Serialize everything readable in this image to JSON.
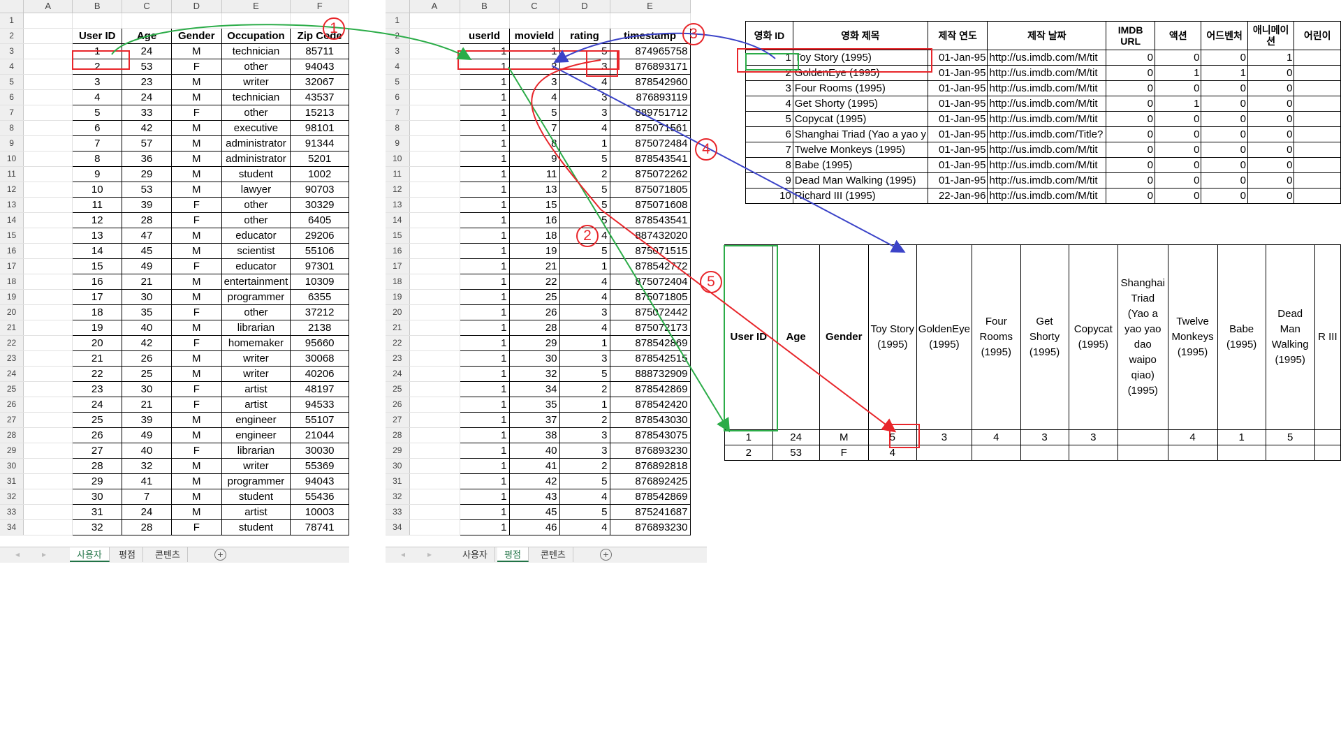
{
  "sheet1": {
    "col_headers": [
      "",
      "A",
      "B",
      "C",
      "D",
      "E",
      "F"
    ],
    "row_numbers": [
      "1",
      "2",
      "3",
      "4",
      "5",
      "6",
      "7",
      "8",
      "9",
      "10",
      "11",
      "12",
      "13",
      "14",
      "15",
      "16",
      "17",
      "18",
      "19",
      "20",
      "21",
      "22",
      "23",
      "24",
      "25",
      "26",
      "27",
      "28",
      "29",
      "30",
      "31",
      "32",
      "33",
      "34"
    ],
    "header": [
      "User ID",
      "Age",
      "Gender",
      "Occupation",
      "Zip Code"
    ],
    "rows": [
      [
        "1",
        "24",
        "M",
        "technician",
        "85711"
      ],
      [
        "2",
        "53",
        "F",
        "other",
        "94043"
      ],
      [
        "3",
        "23",
        "M",
        "writer",
        "32067"
      ],
      [
        "4",
        "24",
        "M",
        "technician",
        "43537"
      ],
      [
        "5",
        "33",
        "F",
        "other",
        "15213"
      ],
      [
        "6",
        "42",
        "M",
        "executive",
        "98101"
      ],
      [
        "7",
        "57",
        "M",
        "administrator",
        "91344"
      ],
      [
        "8",
        "36",
        "M",
        "administrator",
        "5201"
      ],
      [
        "9",
        "29",
        "M",
        "student",
        "1002"
      ],
      [
        "10",
        "53",
        "M",
        "lawyer",
        "90703"
      ],
      [
        "11",
        "39",
        "F",
        "other",
        "30329"
      ],
      [
        "12",
        "28",
        "F",
        "other",
        "6405"
      ],
      [
        "13",
        "47",
        "M",
        "educator",
        "29206"
      ],
      [
        "14",
        "45",
        "M",
        "scientist",
        "55106"
      ],
      [
        "15",
        "49",
        "F",
        "educator",
        "97301"
      ],
      [
        "16",
        "21",
        "M",
        "entertainment",
        "10309"
      ],
      [
        "17",
        "30",
        "M",
        "programmer",
        "6355"
      ],
      [
        "18",
        "35",
        "F",
        "other",
        "37212"
      ],
      [
        "19",
        "40",
        "M",
        "librarian",
        "2138"
      ],
      [
        "20",
        "42",
        "F",
        "homemaker",
        "95660"
      ],
      [
        "21",
        "26",
        "M",
        "writer",
        "30068"
      ],
      [
        "22",
        "25",
        "M",
        "writer",
        "40206"
      ],
      [
        "23",
        "30",
        "F",
        "artist",
        "48197"
      ],
      [
        "24",
        "21",
        "F",
        "artist",
        "94533"
      ],
      [
        "25",
        "39",
        "M",
        "engineer",
        "55107"
      ],
      [
        "26",
        "49",
        "M",
        "engineer",
        "21044"
      ],
      [
        "27",
        "40",
        "F",
        "librarian",
        "30030"
      ],
      [
        "28",
        "32",
        "M",
        "writer",
        "55369"
      ],
      [
        "29",
        "41",
        "M",
        "programmer",
        "94043"
      ],
      [
        "30",
        "7",
        "M",
        "student",
        "55436"
      ],
      [
        "31",
        "24",
        "M",
        "artist",
        "10003"
      ],
      [
        "32",
        "28",
        "F",
        "student",
        "78741"
      ]
    ],
    "tabs": [
      "사용자",
      "평점",
      "콘텐츠"
    ],
    "active_tab": 0
  },
  "sheet2": {
    "col_headers": [
      "",
      "A",
      "B",
      "C",
      "D",
      "E"
    ],
    "header": [
      "userId",
      "movieId",
      "rating",
      "timestamp"
    ],
    "rows": [
      [
        "1",
        "1",
        "5",
        "874965758"
      ],
      [
        "1",
        "2",
        "3",
        "876893171"
      ],
      [
        "1",
        "3",
        "4",
        "878542960"
      ],
      [
        "1",
        "4",
        "3",
        "876893119"
      ],
      [
        "1",
        "5",
        "3",
        "889751712"
      ],
      [
        "1",
        "7",
        "4",
        "875071561"
      ],
      [
        "1",
        "8",
        "1",
        "875072484"
      ],
      [
        "1",
        "9",
        "5",
        "878543541"
      ],
      [
        "1",
        "11",
        "2",
        "875072262"
      ],
      [
        "1",
        "13",
        "5",
        "875071805"
      ],
      [
        "1",
        "15",
        "5",
        "875071608"
      ],
      [
        "1",
        "16",
        "5",
        "878543541"
      ],
      [
        "1",
        "18",
        "4",
        "887432020"
      ],
      [
        "1",
        "19",
        "5",
        "875071515"
      ],
      [
        "1",
        "21",
        "1",
        "878542772"
      ],
      [
        "1",
        "22",
        "4",
        "875072404"
      ],
      [
        "1",
        "25",
        "4",
        "875071805"
      ],
      [
        "1",
        "26",
        "3",
        "875072442"
      ],
      [
        "1",
        "28",
        "4",
        "875072173"
      ],
      [
        "1",
        "29",
        "1",
        "878542869"
      ],
      [
        "1",
        "30",
        "3",
        "878542515"
      ],
      [
        "1",
        "32",
        "5",
        "888732909"
      ],
      [
        "1",
        "34",
        "2",
        "878542869"
      ],
      [
        "1",
        "35",
        "1",
        "878542420"
      ],
      [
        "1",
        "37",
        "2",
        "878543030"
      ],
      [
        "1",
        "38",
        "3",
        "878543075"
      ],
      [
        "1",
        "40",
        "3",
        "876893230"
      ],
      [
        "1",
        "41",
        "2",
        "876892818"
      ],
      [
        "1",
        "42",
        "5",
        "876892425"
      ],
      [
        "1",
        "43",
        "4",
        "878542869"
      ],
      [
        "1",
        "45",
        "5",
        "875241687"
      ],
      [
        "1",
        "46",
        "4",
        "876893230"
      ]
    ],
    "tabs": [
      "사용자",
      "평점",
      "콘텐츠"
    ],
    "active_tab": 1
  },
  "movies": {
    "header": [
      "영화 ID",
      "영화 제목",
      "제작 연도",
      "제작 날짜",
      "IMDB URL",
      "액션",
      "어드벤처",
      "애니메이션",
      "어린이"
    ],
    "rows": [
      [
        "1",
        "Toy Story (1995)",
        "01-Jan-95",
        "http://us.imdb.com/M/tit",
        "0",
        "0",
        "0",
        "1"
      ],
      [
        "2",
        "GoldenEye (1995)",
        "01-Jan-95",
        "http://us.imdb.com/M/tit",
        "0",
        "1",
        "1",
        "0"
      ],
      [
        "3",
        "Four Rooms (1995)",
        "01-Jan-95",
        "http://us.imdb.com/M/tit",
        "0",
        "0",
        "0",
        "0"
      ],
      [
        "4",
        "Get Shorty (1995)",
        "01-Jan-95",
        "http://us.imdb.com/M/tit",
        "0",
        "1",
        "0",
        "0"
      ],
      [
        "5",
        "Copycat (1995)",
        "01-Jan-95",
        "http://us.imdb.com/M/tit",
        "0",
        "0",
        "0",
        "0"
      ],
      [
        "6",
        "Shanghai Triad (Yao a yao y",
        "01-Jan-95",
        "http://us.imdb.com/Title?",
        "0",
        "0",
        "0",
        "0"
      ],
      [
        "7",
        "Twelve Monkeys (1995)",
        "01-Jan-95",
        "http://us.imdb.com/M/tit",
        "0",
        "0",
        "0",
        "0"
      ],
      [
        "8",
        "Babe (1995)",
        "01-Jan-95",
        "http://us.imdb.com/M/tit",
        "0",
        "0",
        "0",
        "0"
      ],
      [
        "9",
        "Dead Man Walking (1995)",
        "01-Jan-95",
        "http://us.imdb.com/M/tit",
        "0",
        "0",
        "0",
        "0"
      ],
      [
        "10",
        "Richard III (1995)",
        "22-Jan-96",
        "http://us.imdb.com/M/tit",
        "0",
        "0",
        "0",
        "0"
      ]
    ]
  },
  "pivot": {
    "header": [
      "User ID",
      "Age",
      "Gender",
      "Toy Story (1995)",
      "GoldenEye (1995)",
      "Four Rooms (1995)",
      "Get Shorty (1995)",
      "Copycat (1995)",
      "Shanghai Triad (Yao a yao yao dao waipo qiao) (1995)",
      "Twelve Monkeys (1995)",
      "Babe (1995)",
      "Dead Man Walking (1995)",
      "R III"
    ],
    "rows": [
      [
        "1",
        "24",
        "M",
        "5",
        "3",
        "4",
        "3",
        "3",
        "",
        "4",
        "1",
        "5",
        ""
      ],
      [
        "2",
        "53",
        "F",
        "4",
        "",
        "",
        "",
        "",
        "",
        "",
        "",
        "",
        ""
      ]
    ]
  },
  "markers": [
    "1",
    "2",
    "3",
    "4",
    "5"
  ],
  "colors": {
    "red": "#e8262b",
    "green": "#2bac48",
    "blue": "#3b43c8",
    "excel_green": "#217346"
  }
}
